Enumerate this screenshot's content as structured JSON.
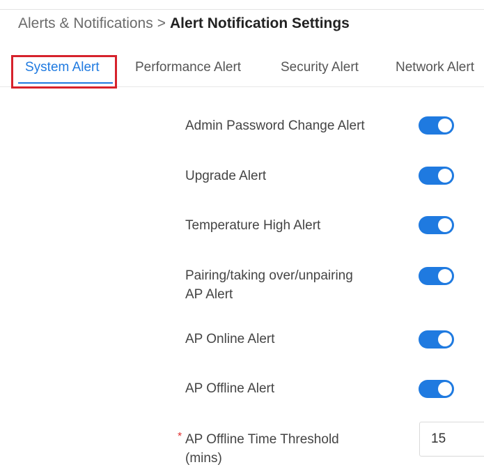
{
  "breadcrumb": {
    "parent": "Alerts & Notifications",
    "separator": ">",
    "current": "Alert Notification Settings"
  },
  "tabs": [
    {
      "label": "System Alert",
      "active": true
    },
    {
      "label": "Performance Alert",
      "active": false
    },
    {
      "label": "Security Alert",
      "active": false
    },
    {
      "label": "Network Alert",
      "active": false
    }
  ],
  "settings": [
    {
      "label": "Admin Password Change Alert",
      "enabled": true
    },
    {
      "label": "Upgrade Alert",
      "enabled": true
    },
    {
      "label": "Temperature High Alert",
      "enabled": true
    },
    {
      "label": "Pairing/taking over/unpairing AP Alert",
      "label_line1": "Pairing/taking over/unpairing",
      "label_line2": "AP Alert",
      "enabled": true
    },
    {
      "label": "AP Online Alert",
      "enabled": true
    },
    {
      "label": "AP Offline Alert",
      "enabled": true
    }
  ],
  "threshold": {
    "required_mark": "*",
    "label_line1": "AP Offline Time Threshold",
    "label_line2": "(mins)",
    "value": "15"
  },
  "colors": {
    "accent": "#1f7ae0",
    "highlight": "#d6222c",
    "required": "#e03030"
  }
}
